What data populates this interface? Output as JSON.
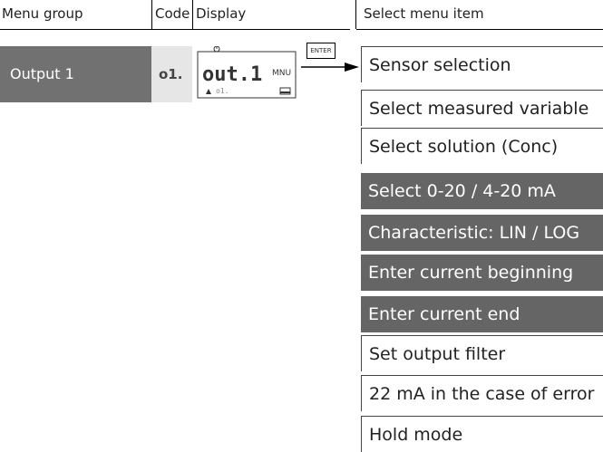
{
  "header": {
    "menu_group": "Menu group",
    "code": "Code",
    "display": "Display",
    "select_menu_item": "Select menu item"
  },
  "row": {
    "group": "Output 1",
    "code": "o1.",
    "display_main": "out.1",
    "display_mode": "MNU",
    "display_sub": "o1."
  },
  "enter_key": "ENTER",
  "menu_items": [
    {
      "label": "Sensor selection",
      "style": "light"
    },
    {
      "label": "Select measured variable",
      "style": "light"
    },
    {
      "label": "Select solution (Conc)",
      "style": "light"
    },
    {
      "label": "Select 0-20 / 4-20 mA",
      "style": "dark"
    },
    {
      "label": "Characteristic: LIN / LOG",
      "style": "dark"
    },
    {
      "label": "Enter current beginning",
      "style": "dark"
    },
    {
      "label": "Enter current end",
      "style": "dark"
    },
    {
      "label": "Set output filter",
      "style": "light"
    },
    {
      "label": "22 mA in the case of error",
      "style": "light"
    },
    {
      "label": "Hold mode",
      "style": "light"
    }
  ],
  "colors": {
    "dark_box": "#656565",
    "group_box": "#717171",
    "code_box": "#e6e6e6"
  }
}
